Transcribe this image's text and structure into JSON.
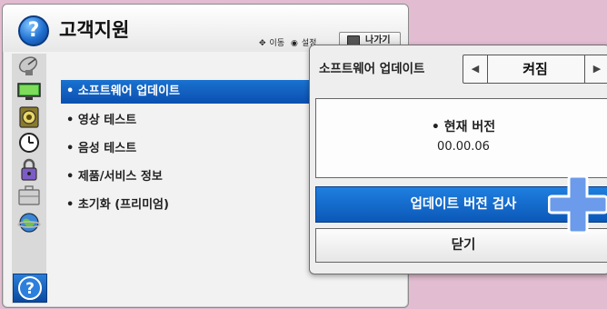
{
  "window": {
    "title": "고객지원",
    "hint_move": "이동",
    "hint_set": "설정",
    "exit_label": "나가기"
  },
  "sidebar_icons": [
    "satellite-dish-icon",
    "monitor-icon",
    "speaker-icon",
    "clock-icon",
    "lock-icon",
    "briefcase-icon",
    "globe-icon",
    "help-icon"
  ],
  "menu": {
    "items": [
      "• 소프트웨어 업데이트",
      "• 영상 테스트",
      "• 음성 테스트",
      "• 제품/서비스 정보",
      "• 초기화 (프리미엄)"
    ]
  },
  "popup": {
    "label": "소프트웨어 업데이트",
    "toggle_value": "켜짐",
    "current_version_title": "• 현재 버전",
    "current_version": "00.00.06",
    "check_button": "업데이트 버전 검사",
    "close_button": "닫기"
  },
  "colors": {
    "background": "#e2bcd0",
    "highlight": "#0b58b8",
    "cursor": "#5b8de0"
  }
}
